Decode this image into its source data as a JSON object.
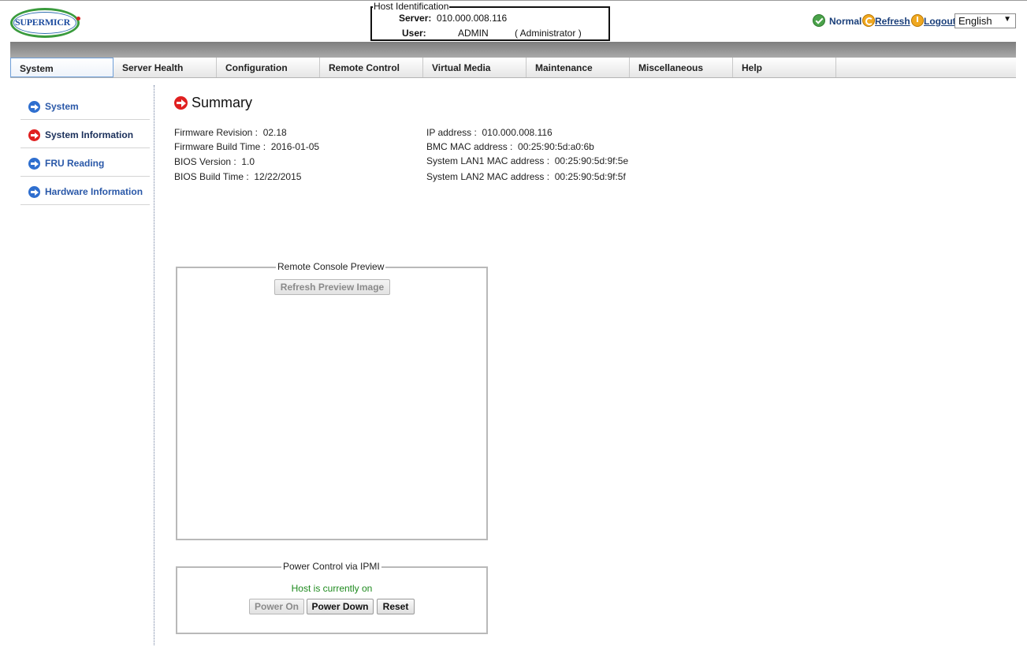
{
  "brand": {
    "logo_text": "SUPERMICR"
  },
  "host": {
    "legend": "Host Identification",
    "server_label": "Server:",
    "server_value": "010.000.008.116",
    "user_label": "User:",
    "user_value": "ADMIN",
    "user_role": "( Administrator )"
  },
  "topbar": {
    "status": "Normal",
    "refresh": "Refresh",
    "logout": "Logout",
    "language": "English",
    "language_arrow": "▼"
  },
  "nav": {
    "items": [
      {
        "label": "System"
      },
      {
        "label": "Server Health"
      },
      {
        "label": "Configuration"
      },
      {
        "label": "Remote Control"
      },
      {
        "label": "Virtual Media"
      },
      {
        "label": "Maintenance"
      },
      {
        "label": "Miscellaneous"
      },
      {
        "label": "Help"
      }
    ],
    "active": "System"
  },
  "sidebar": {
    "items": [
      {
        "label": "System"
      },
      {
        "label": "System Information"
      },
      {
        "label": "FRU Reading"
      },
      {
        "label": "Hardware Information"
      }
    ],
    "active": "System Information"
  },
  "summary": {
    "title": "Summary",
    "left": [
      {
        "label": "Firmware Revision :",
        "value": "02.18"
      },
      {
        "label": "Firmware Build Time :",
        "value": "2016-01-05"
      },
      {
        "label": "BIOS Version :",
        "value": "1.0"
      },
      {
        "label": "BIOS Build Time :",
        "value": "12/22/2015"
      }
    ],
    "right": [
      {
        "label": "IP address :",
        "value": "010.000.008.116"
      },
      {
        "label": "BMC MAC address :",
        "value": "00:25:90:5d:a0:6b"
      },
      {
        "label": "System LAN1 MAC address :",
        "value": "00:25:90:5d:9f:5e"
      },
      {
        "label": "System LAN2 MAC address :",
        "value": "00:25:90:5d:9f:5f"
      }
    ]
  },
  "console": {
    "legend": "Remote Console Preview",
    "refresh_button": "Refresh Preview Image"
  },
  "power": {
    "legend": "Power Control via IPMI",
    "status": "Host is currently on",
    "power_on": "Power On",
    "power_down": "Power Down",
    "reset": "Reset"
  },
  "colors": {
    "accent_red": "#e02020",
    "link_blue": "#2a58a8",
    "status_green": "#1e8a1e"
  }
}
